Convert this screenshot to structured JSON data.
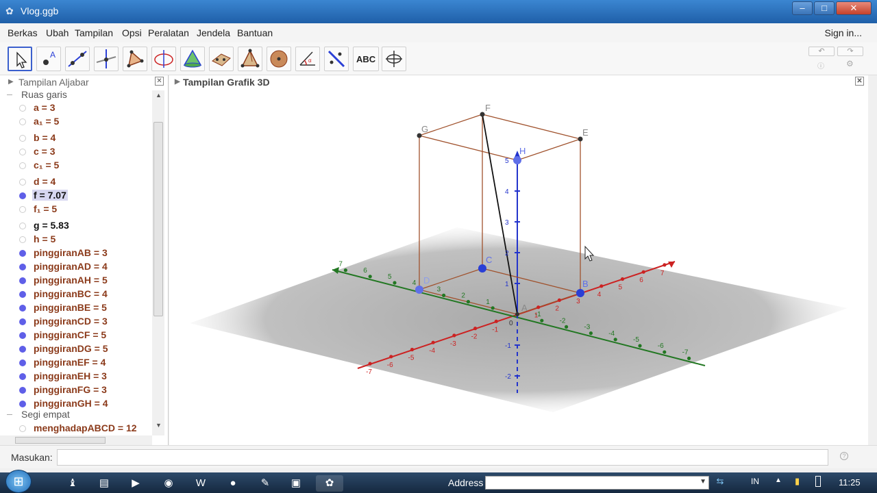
{
  "window": {
    "title": "Vlog.ggb"
  },
  "menu": [
    "Berkas",
    "Ubah",
    "Tampilan",
    "Opsi",
    "Peralatan",
    "Jendela",
    "Bantuan"
  ],
  "signin": "Sign in...",
  "toolbar": {
    "tools": [
      "move",
      "point",
      "line",
      "perpendicular-line",
      "polygon",
      "circle",
      "pyramid",
      "net",
      "tetrahedron",
      "sphere",
      "angle",
      "reflect",
      "text",
      "rotate-view"
    ],
    "text_tool_label": "ABC",
    "undo": "↶",
    "redo": "↷"
  },
  "algebra": {
    "title": "Tampilan Aljabar",
    "groups": [
      {
        "label": "Ruas garis"
      },
      {
        "label": "Segi empat"
      }
    ],
    "rows": [
      {
        "text": "a = 3",
        "visible": false,
        "color": "brown"
      },
      {
        "text": "a₁ = 5",
        "visible": false,
        "color": "brown"
      },
      {
        "text": "b = 4",
        "visible": false,
        "color": "brown"
      },
      {
        "text": "c = 3",
        "visible": false,
        "color": "brown"
      },
      {
        "text": "c₁ = 5",
        "visible": false,
        "color": "brown"
      },
      {
        "text": "d = 4",
        "visible": false,
        "color": "brown"
      },
      {
        "text": "f = 7.07",
        "visible": true,
        "color": "black",
        "selected": true
      },
      {
        "text": "f₁ = 5",
        "visible": false,
        "color": "brown"
      },
      {
        "text": "g = 5.83",
        "visible": false,
        "color": "black"
      },
      {
        "text": "h = 5",
        "visible": false,
        "color": "brown"
      },
      {
        "text": "pinggiranAB = 3",
        "visible": true,
        "color": "brown"
      },
      {
        "text": "pinggiranAD = 4",
        "visible": true,
        "color": "brown"
      },
      {
        "text": "pinggiranAH = 5",
        "visible": true,
        "color": "brown"
      },
      {
        "text": "pinggiranBC = 4",
        "visible": true,
        "color": "brown"
      },
      {
        "text": "pinggiranBE = 5",
        "visible": true,
        "color": "brown"
      },
      {
        "text": "pinggiranCD = 3",
        "visible": true,
        "color": "brown"
      },
      {
        "text": "pinggiranCF = 5",
        "visible": true,
        "color": "brown"
      },
      {
        "text": "pinggiranDG = 5",
        "visible": true,
        "color": "brown"
      },
      {
        "text": "pinggiranEF = 4",
        "visible": true,
        "color": "brown"
      },
      {
        "text": "pinggiranEH = 3",
        "visible": true,
        "color": "brown"
      },
      {
        "text": "pinggiranFG = 3",
        "visible": true,
        "color": "brown"
      },
      {
        "text": "pinggiranGH = 4",
        "visible": true,
        "color": "brown"
      }
    ],
    "last_row": "menghadapABCD = 12"
  },
  "graphics3d": {
    "title": "Tampilan Grafik 3D",
    "points": [
      "A",
      "B",
      "C",
      "D",
      "E",
      "F",
      "G",
      "H"
    ],
    "axis_ticks": {
      "x": [
        "-7",
        "-6",
        "-5",
        "-4",
        "-3",
        "-2",
        "-1",
        "1",
        "2",
        "3",
        "4",
        "5",
        "6",
        "7"
      ],
      "y": [
        "7",
        "6",
        "5",
        "4",
        "3",
        "2",
        "1",
        "0",
        "-1",
        "-2",
        "-3",
        "-4",
        "-5",
        "-6",
        "-7"
      ],
      "z": [
        "5",
        "4",
        "3",
        "2",
        "1",
        "-1",
        "-2"
      ]
    },
    "colors": {
      "x_axis": "#cc2222",
      "y_axis": "#227722",
      "z_axis": "#2233cc",
      "box": "#a0522d",
      "diagonal": "#111111",
      "point": "#2a3fd6"
    }
  },
  "input": {
    "label": "Masukan:",
    "value": "",
    "help": "?"
  },
  "taskbar": {
    "address_label": "Address",
    "address_value": "",
    "language": "IN",
    "clock": "11:25"
  }
}
